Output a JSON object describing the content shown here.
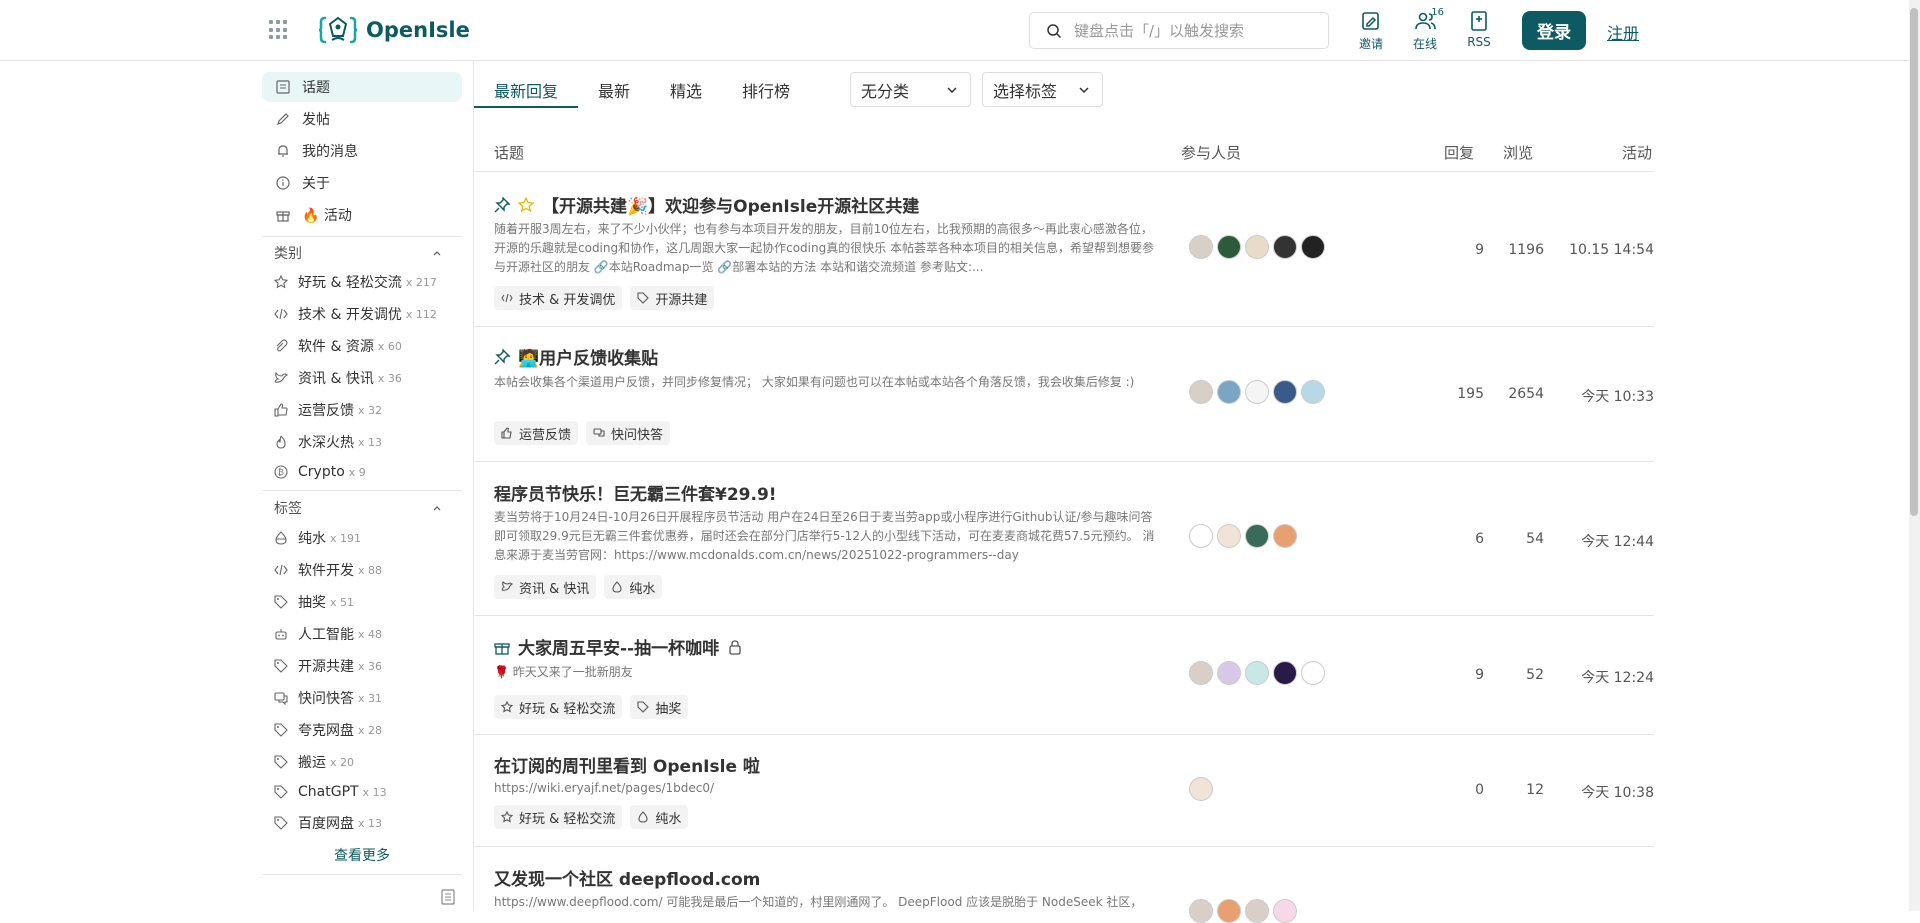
{
  "header": {
    "logo_text": "OpenIsle",
    "search_placeholder": "键盘点击「/」以触发搜索",
    "invite_label": "邀请",
    "online_label": "在线",
    "online_count": "16",
    "rss_label": "RSS",
    "login_label": "登录",
    "register_label": "注册"
  },
  "sidebar": {
    "nav": [
      {
        "label": "话题",
        "icon": "topic-icon"
      },
      {
        "label": "发帖",
        "icon": "pen-icon"
      },
      {
        "label": "我的消息",
        "icon": "bell-icon"
      },
      {
        "label": "关于",
        "icon": "info-icon"
      },
      {
        "label": "🔥 活动",
        "icon": "gift-icon"
      }
    ],
    "categories_title": "类别",
    "categories": [
      {
        "label": "好玩 & 轻松交流",
        "count": "x 217",
        "icon": "star-icon"
      },
      {
        "label": "技术 & 开发调优",
        "count": "x 112",
        "icon": "code-icon"
      },
      {
        "label": "软件 & 资源",
        "count": "x 60",
        "icon": "paperclip-icon"
      },
      {
        "label": "资讯 & 快讯",
        "count": "x 36",
        "icon": "bird-icon"
      },
      {
        "label": "运营反馈",
        "count": "x 32",
        "icon": "thumbs-up-icon"
      },
      {
        "label": "水深火热",
        "count": "x 13",
        "icon": "flame-icon"
      },
      {
        "label": "Crypto",
        "count": "x 9",
        "icon": "bitcoin-icon"
      }
    ],
    "tags_title": "标签",
    "tags": [
      {
        "label": "纯水",
        "count": "x 191",
        "icon": "egg-icon"
      },
      {
        "label": "软件开发",
        "count": "x 88",
        "icon": "code-icon"
      },
      {
        "label": "抽奖",
        "count": "x 51",
        "icon": "tag-icon"
      },
      {
        "label": "人工智能",
        "count": "x 48",
        "icon": "robot-icon"
      },
      {
        "label": "开源共建",
        "count": "x 36",
        "icon": "tag-icon"
      },
      {
        "label": "快问快答",
        "count": "x 31",
        "icon": "chat-icon"
      },
      {
        "label": "夸克网盘",
        "count": "x 28",
        "icon": "tag-icon"
      },
      {
        "label": "搬运",
        "count": "x 20",
        "icon": "tag-icon"
      },
      {
        "label": "ChatGPT",
        "count": "x 13",
        "icon": "tag-icon"
      },
      {
        "label": "百度网盘",
        "count": "x 13",
        "icon": "tag-icon"
      }
    ],
    "see_more": "查看更多"
  },
  "tabs": [
    "最新回复",
    "最新",
    "精选",
    "排行榜"
  ],
  "filters": {
    "category": "无分类",
    "tag": "选择标签"
  },
  "table_head": {
    "topic": "话题",
    "participants": "参与人员",
    "replies": "回复",
    "views": "浏览",
    "activity": "活动"
  },
  "posts": [
    {
      "title": "【开源共建🎉】欢迎参与OpenIsle开源社区共建",
      "excerpt": "随着开服3周左右，来了不少小伙伴；也有参与本项目开发的朋友，目前10位左右，比我预期的高很多～再此衷心感激各位，开源的乐趣就是coding和协作，这几周跟大家一起协作coding真的很快乐 本帖荟萃各种本项目的相关信息，希望帮到想要参与开源社区的朋友 🔗本站Roadmap一览 🔗部署本站的方法 本站和谐交流频道 参考贴文:...",
      "tags": [
        {
          "label": "技术 & 开发调优",
          "icon": "code-icon"
        },
        {
          "label": "开源共建",
          "icon": "tag-icon"
        }
      ],
      "replies": "9",
      "views": "1196",
      "activity": "10.15 14:54"
    },
    {
      "title": "🧑‍💻用户反馈收集贴",
      "excerpt": "本帖会收集各个渠道用户反馈，并同步修复情况； 大家如果有问题也可以在本帖或本站各个角落反馈，我会收集后修复 :)",
      "tags": [
        {
          "label": "运营反馈",
          "icon": "thumbs-up-icon"
        },
        {
          "label": "快问快答",
          "icon": "chat-icon"
        }
      ],
      "replies": "195",
      "views": "2654",
      "activity": "今天 10:33"
    },
    {
      "title": "程序员节快乐！巨无霸三件套¥29.9!",
      "excerpt": "麦当劳将于10月24日-10月26日开展程序员节活动 用户在24日至26日于麦当劳app或小程序进行Github认证/参与趣味问答即可领取29.9元巨无霸三件套优惠券，届时还会在部分门店举行5-12人的小型线下活动，可在麦麦商城花费57.5元预约。 消息来源于麦当劳官网：https://www.mcdonalds.com.cn/news/20251022-programmers--day",
      "tags": [
        {
          "label": "资讯 & 快讯",
          "icon": "bird-icon"
        },
        {
          "label": "纯水",
          "icon": "egg-icon"
        }
      ],
      "replies": "6",
      "views": "54",
      "activity": "今天 12:44"
    },
    {
      "title": "大家周五早安--抽一杯咖啡",
      "excerpt": "🌹 昨天又来了一批新朋友",
      "tags": [
        {
          "label": "好玩 & 轻松交流",
          "icon": "star-icon"
        },
        {
          "label": "抽奖",
          "icon": "tag-icon"
        }
      ],
      "replies": "9",
      "views": "52",
      "activity": "今天 12:24"
    },
    {
      "title": "在订阅的周刊里看到 OpenIsle 啦",
      "excerpt": "https://wiki.eryajf.net/pages/1bdec0/",
      "tags": [
        {
          "label": "好玩 & 轻松交流",
          "icon": "star-icon"
        },
        {
          "label": "纯水",
          "icon": "egg-icon"
        }
      ],
      "replies": "0",
      "views": "12",
      "activity": "今天 10:38"
    },
    {
      "title": "又发现一个社区 deepflood.com",
      "excerpt": "https://www.deepflood.com/ 可能我是最后一个知道的，村里刚通网了。 DeepFlood 应该是脱胎于 NodeSeek 社区，",
      "tags": [],
      "replies": "",
      "views": "",
      "activity": ""
    }
  ],
  "colors": {
    "accent": "#0e5a63",
    "active_bg": "#e8f6f8"
  }
}
